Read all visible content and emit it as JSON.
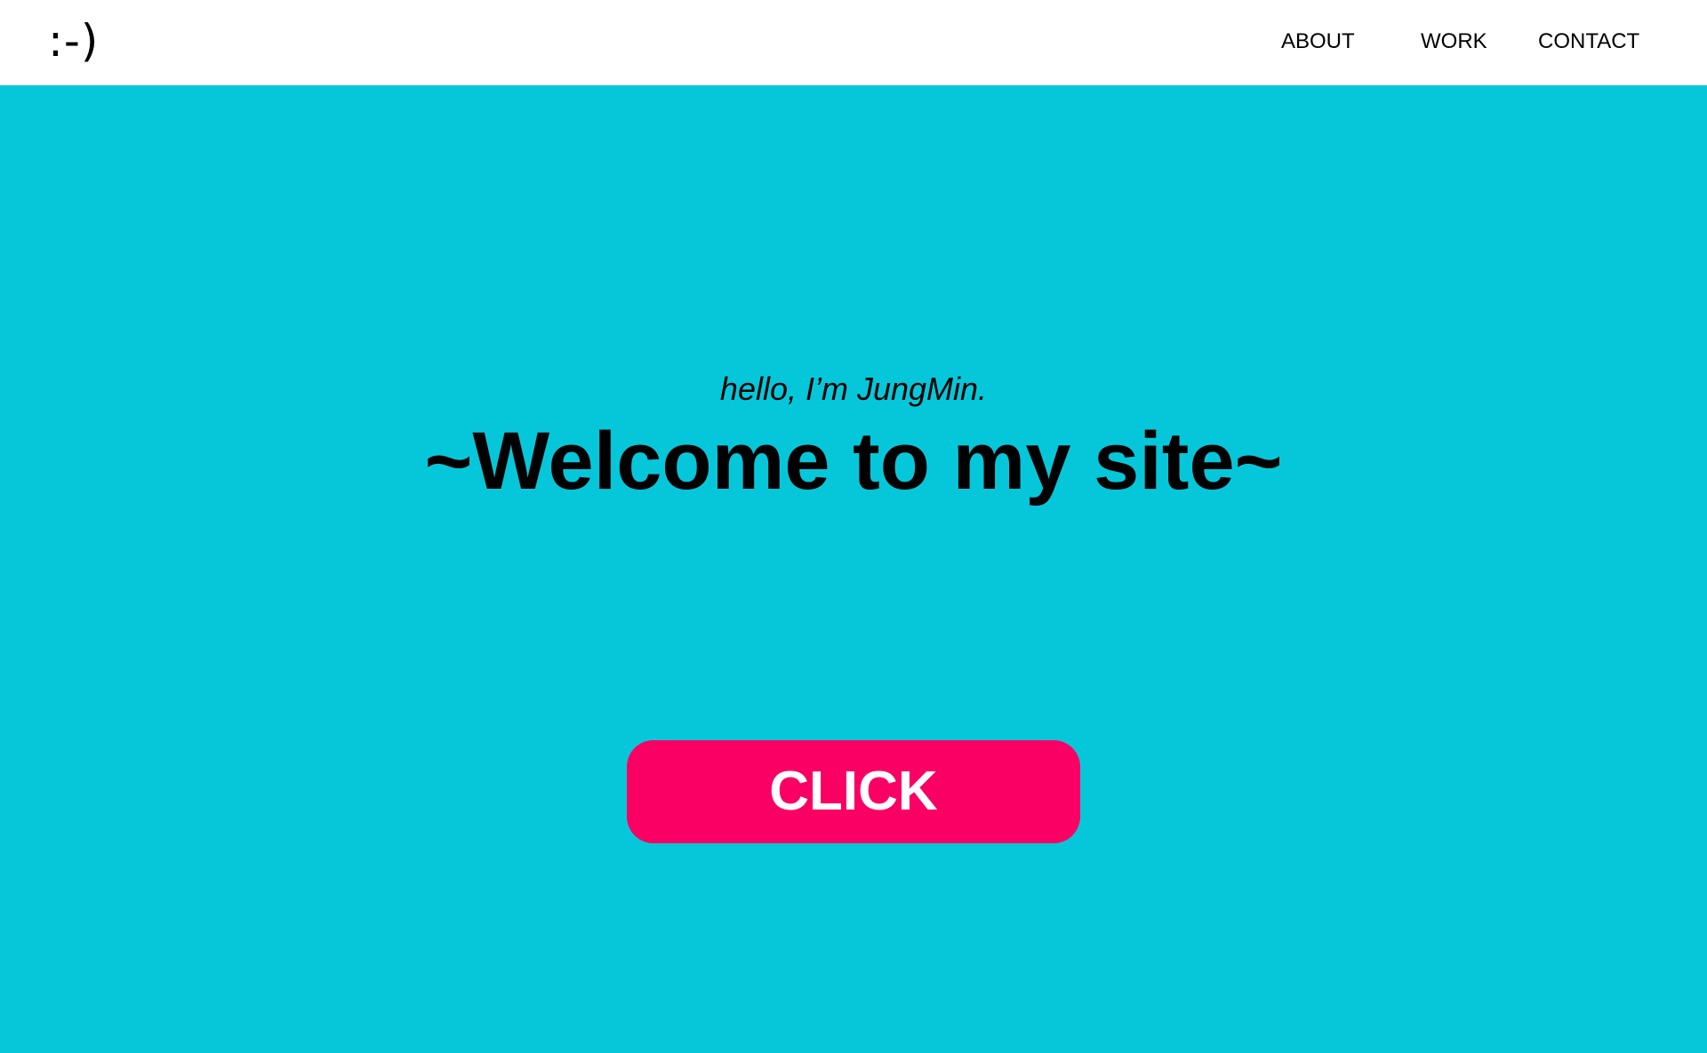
{
  "header": {
    "logo_text": ":-)",
    "nav": {
      "about": "ABOUT",
      "work": "WORK",
      "contact": "CONTACT"
    }
  },
  "hero": {
    "intro": "hello, I’m JungMin.",
    "title": "~Welcome to my site~",
    "cta_label": "CLICK"
  },
  "colors": {
    "hero_background": "#06c7da",
    "cta_background": "#fb0064",
    "header_background": "#ffffff"
  }
}
